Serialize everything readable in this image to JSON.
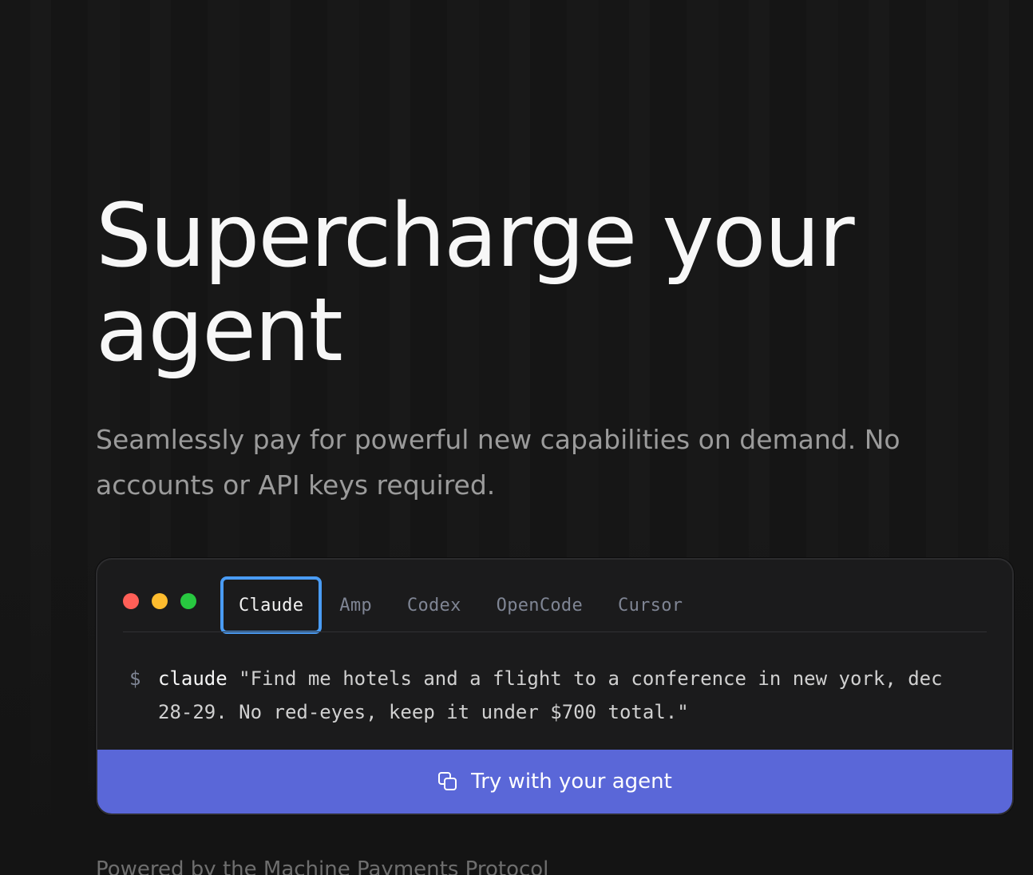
{
  "hero": {
    "title_line1": "Supercharge your",
    "title_line2": "agent",
    "subtitle": "Seamlessly pay for powerful new capabilities on demand. No accounts or API keys required."
  },
  "terminal": {
    "tabs": [
      {
        "label": "Claude",
        "active": true
      },
      {
        "label": "Amp",
        "active": false
      },
      {
        "label": "Codex",
        "active": false
      },
      {
        "label": "OpenCode",
        "active": false
      },
      {
        "label": "Cursor",
        "active": false
      }
    ],
    "prompt_symbol": "$",
    "command_name": "claude",
    "command_argument": "\"Find me hotels and a flight to a conference in new york, dec 28-29. No red-eyes, keep it under $700 total.\"",
    "cta_label": "Try with your agent",
    "cta_icon": "copy-icon"
  },
  "footer": {
    "powered_by": "Powered by the Machine Payments Protocol"
  },
  "colors": {
    "background": "#141414",
    "accent": "#5a67d8",
    "active_tab_border": "#4a9cf5",
    "dot_red": "#ff5f57",
    "dot_yellow": "#febc2e",
    "dot_green": "#28c840"
  }
}
